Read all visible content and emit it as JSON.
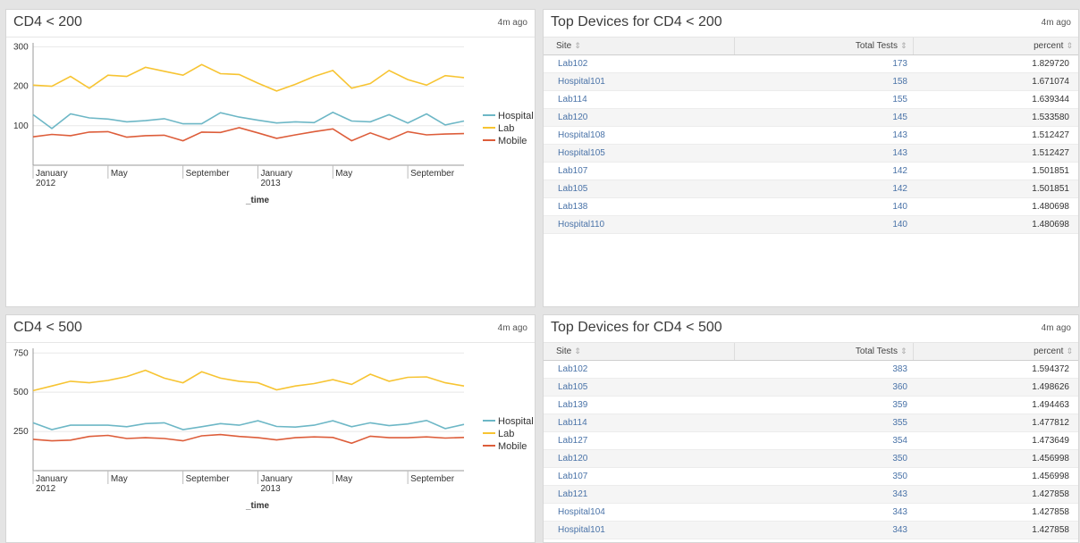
{
  "panels": [
    {
      "title": "CD4 < 200",
      "ago": "4m ago",
      "chart_data": {
        "type": "line",
        "y_ticks": [
          100,
          200,
          300
        ],
        "ylim": [
          0,
          310
        ],
        "x_ticks": [
          {
            "label": "January",
            "sub": "2012",
            "index": 0
          },
          {
            "label": "May",
            "sub": "",
            "index": 4
          },
          {
            "label": "September",
            "sub": "",
            "index": 8
          },
          {
            "label": "January",
            "sub": "2013",
            "index": 12
          },
          {
            "label": "May",
            "sub": "",
            "index": 16
          },
          {
            "label": "September",
            "sub": "",
            "index": 20
          }
        ],
        "n_points": 24,
        "xlabel": "_time",
        "series": [
          {
            "name": "Hospital",
            "color": "#6db7c6",
            "values": [
              128,
              93,
              130,
              120,
              117,
              110,
              113,
              118,
              105,
              105,
              133,
              122,
              114,
              107,
              110,
              108,
              134,
              112,
              110,
              128,
              107,
              130,
              102,
              112
            ]
          },
          {
            "name": "Lab",
            "color": "#f7c432",
            "values": [
              203,
              200,
              225,
              195,
              228,
              225,
              248,
              238,
              228,
              255,
              232,
              230,
              208,
              188,
              205,
              225,
              240,
              195,
              207,
              240,
              217,
              203,
              227,
              222
            ]
          },
          {
            "name": "Mobile",
            "color": "#dd5d3a",
            "values": [
              72,
              78,
              75,
              84,
              85,
              71,
              75,
              76,
              62,
              84,
              83,
              95,
              82,
              68,
              77,
              85,
              92,
              62,
              82,
              65,
              85,
              77,
              79,
              80
            ]
          }
        ]
      }
    },
    {
      "title": "CD4 < 500",
      "ago": "4m ago",
      "chart_data": {
        "type": "line",
        "y_ticks": [
          250,
          500,
          750
        ],
        "ylim": [
          0,
          780
        ],
        "x_ticks": [
          {
            "label": "January",
            "sub": "2012",
            "index": 0
          },
          {
            "label": "May",
            "sub": "",
            "index": 4
          },
          {
            "label": "September",
            "sub": "",
            "index": 8
          },
          {
            "label": "January",
            "sub": "2013",
            "index": 12
          },
          {
            "label": "May",
            "sub": "",
            "index": 16
          },
          {
            "label": "September",
            "sub": "",
            "index": 20
          }
        ],
        "n_points": 24,
        "xlabel": "_time",
        "series": [
          {
            "name": "Hospital",
            "color": "#6db7c6",
            "values": [
              305,
              262,
              290,
              290,
              290,
              280,
              300,
              305,
              262,
              280,
              300,
              290,
              318,
              282,
              278,
              290,
              318,
              280,
              305,
              287,
              298,
              320,
              268,
              295
            ]
          },
          {
            "name": "Lab",
            "color": "#f7c432",
            "values": [
              510,
              540,
              570,
              560,
              575,
              600,
              640,
              590,
              560,
              630,
              590,
              570,
              560,
              515,
              540,
              555,
              580,
              550,
              615,
              570,
              595,
              598,
              560,
              540
            ]
          },
          {
            "name": "Mobile",
            "color": "#dd5d3a",
            "values": [
              200,
              190,
              195,
              218,
              225,
              205,
              210,
              205,
              190,
              222,
              230,
              218,
              210,
              196,
              210,
              215,
              212,
              175,
              220,
              210,
              210,
              215,
              208,
              212
            ]
          }
        ]
      }
    }
  ],
  "tables": [
    {
      "title": "Top Devices for CD4 < 200",
      "ago": "4m ago",
      "headers": [
        "Site",
        "Total Tests",
        "percent"
      ],
      "rows": [
        [
          "Lab102",
          "173",
          "1.829720"
        ],
        [
          "Hospital101",
          "158",
          "1.671074"
        ],
        [
          "Lab114",
          "155",
          "1.639344"
        ],
        [
          "Lab120",
          "145",
          "1.533580"
        ],
        [
          "Hospital108",
          "143",
          "1.512427"
        ],
        [
          "Hospital105",
          "143",
          "1.512427"
        ],
        [
          "Lab107",
          "142",
          "1.501851"
        ],
        [
          "Lab105",
          "142",
          "1.501851"
        ],
        [
          "Lab138",
          "140",
          "1.480698"
        ],
        [
          "Hospital110",
          "140",
          "1.480698"
        ]
      ]
    },
    {
      "title": "Top Devices for CD4 < 500",
      "ago": "4m ago",
      "headers": [
        "Site",
        "Total Tests",
        "percent"
      ],
      "rows": [
        [
          "Lab102",
          "383",
          "1.594372"
        ],
        [
          "Lab105",
          "360",
          "1.498626"
        ],
        [
          "Lab139",
          "359",
          "1.494463"
        ],
        [
          "Lab114",
          "355",
          "1.477812"
        ],
        [
          "Lab127",
          "354",
          "1.473649"
        ],
        [
          "Lab120",
          "350",
          "1.456998"
        ],
        [
          "Lab107",
          "350",
          "1.456998"
        ],
        [
          "Lab121",
          "343",
          "1.427858"
        ],
        [
          "Hospital104",
          "343",
          "1.427858"
        ],
        [
          "Hospital101",
          "343",
          "1.427858"
        ]
      ]
    }
  ],
  "sort_icon": "sort-arrows-icon"
}
